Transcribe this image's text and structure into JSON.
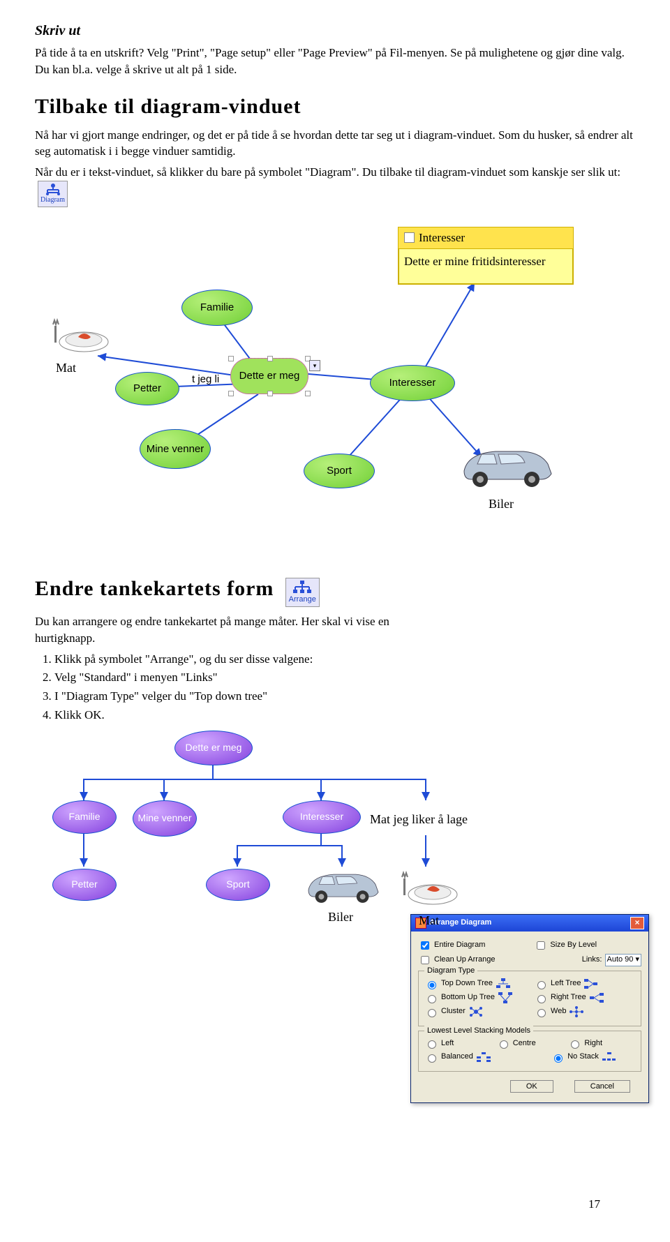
{
  "skrivut": {
    "heading": "Skriv ut",
    "body": "På tide å ta en utskrift? Velg \"Print\", \"Page setup\" eller \"Page Preview\" på Fil-menyen. Se på mulighetene og gjør dine valg. Du kan bl.a. velge å skrive ut alt på 1 side."
  },
  "tilbake": {
    "heading": "Tilbake til diagram-vinduet",
    "p1": "Nå har vi gjort mange endringer, og det er på tide å se hvordan dette tar seg ut i diagram-vinduet. Som du husker, så endrer alt seg automatisk i i begge vinduer samtidig.",
    "p2": "Når du er i tekst-vinduet, så klikker du bare på symbolet \"Diagram\". Du tilbake til diagram-vinduet som kanskje ser slik ut:",
    "icon_label": "Diagram"
  },
  "mindmap": {
    "sticky_title": "Interesser",
    "sticky_body": "Dette er mine fritidsinteresser",
    "nodes": {
      "familie": "Familie",
      "mat": "Mat",
      "petter": "Petter",
      "center": "Dette er meg",
      "center_partial": "t jeg li",
      "interesser": "Interesser",
      "venner": "Mine venner",
      "sport": "Sport",
      "biler": "Biler"
    }
  },
  "endre": {
    "heading": "Endre tankekartets form",
    "icon_label": "Arrange",
    "intro": "Du kan arrangere og endre tankekartet på mange måter. Her skal vi vise en hurtigknapp.",
    "steps": [
      "Klikk på symbolet \"Arrange\", og du ser disse valgene:",
      "Velg \"Standard\" i menyen \"Links\"",
      "I \"Diagram Type\" velger du \"Top down tree\"",
      "Klikk OK."
    ]
  },
  "dialog": {
    "title": "Arrange Diagram",
    "entire": "Entire Diagram",
    "cleanup": "Clean Up Arrange",
    "sizeby": "Size By Level",
    "links_label": "Links:",
    "links_value": "Auto 90",
    "diagtype_legend": "Diagram Type",
    "topdown": "Top Down Tree",
    "bottomup": "Bottom Up Tree",
    "cluster": "Cluster",
    "lefttree": "Left Tree",
    "righttree": "Right Tree",
    "web": "Web",
    "stack_legend": "Lowest Level Stacking Models",
    "left": "Left",
    "centre": "Centre",
    "right": "Right",
    "balanced": "Balanced",
    "nostack": "No Stack",
    "ok": "OK",
    "cancel": "Cancel"
  },
  "tree": {
    "root": "Dette er meg",
    "familie": "Familie",
    "venner": "Mine venner",
    "interesser": "Interesser",
    "mat": "Mat jeg liker å lage",
    "petter": "Petter",
    "sport": "Sport",
    "mat_label": "Mat",
    "biler": "Biler"
  },
  "page_num": "17"
}
